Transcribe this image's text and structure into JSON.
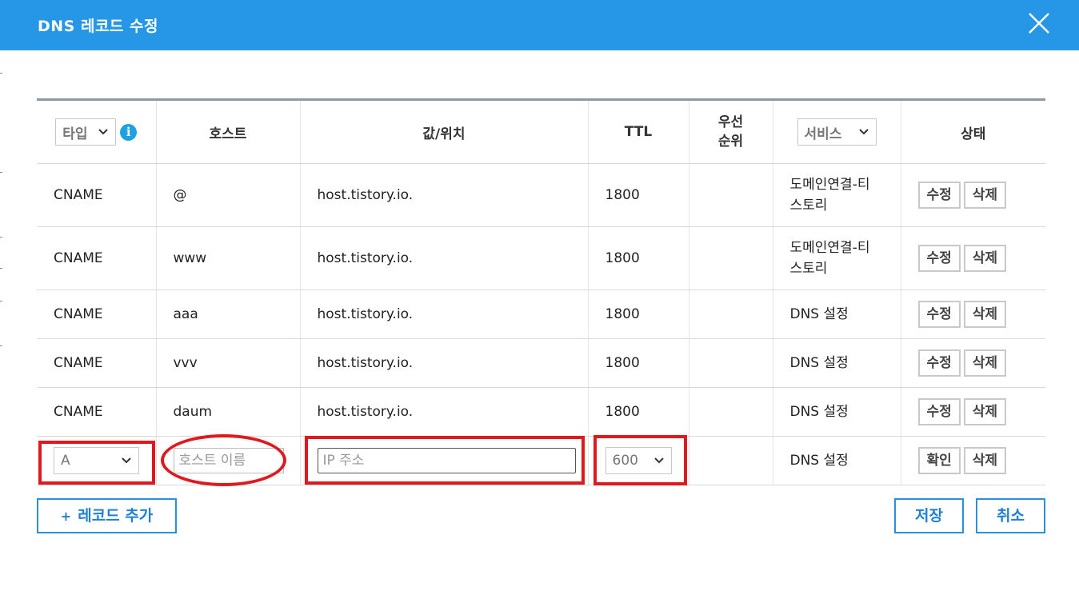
{
  "dialog": {
    "title": "DNS 레코드 수정",
    "close_icon": "close-icon"
  },
  "columns": {
    "type_filter": "타입",
    "host": "호스트",
    "value": "값/위치",
    "ttl": "TTL",
    "priority": "우선\n순위",
    "service_filter": "서비스",
    "status": "상태"
  },
  "rows": [
    {
      "type": "CNAME",
      "host": "@",
      "value": "host.tistory.io.",
      "ttl": "1800",
      "priority": "",
      "service": "도메인연결-티\n스토리",
      "edit": "수정",
      "delete": "삭제"
    },
    {
      "type": "CNAME",
      "host": "www",
      "value": "host.tistory.io.",
      "ttl": "1800",
      "priority": "",
      "service": "도메인연결-티\n스토리",
      "edit": "수정",
      "delete": "삭제"
    },
    {
      "type": "CNAME",
      "host": "aaa",
      "value": "host.tistory.io.",
      "ttl": "1800",
      "priority": "",
      "service": "DNS 설정",
      "edit": "수정",
      "delete": "삭제"
    },
    {
      "type": "CNAME",
      "host": "vvv",
      "value": "host.tistory.io.",
      "ttl": "1800",
      "priority": "",
      "service": "DNS 설정",
      "edit": "수정",
      "delete": "삭제"
    },
    {
      "type": "CNAME",
      "host": "daum",
      "value": "host.tistory.io.",
      "ttl": "1800",
      "priority": "",
      "service": "DNS 설정",
      "edit": "수정",
      "delete": "삭제"
    }
  ],
  "new_row": {
    "type_selected": "A",
    "host_placeholder": "호스트 이름",
    "host_value": "",
    "value_placeholder": "IP 주소",
    "value_value": "",
    "ttl_selected": "600",
    "service": "DNS 설정",
    "confirm": "확인",
    "delete": "삭제"
  },
  "footer": {
    "add_record": "레코드 추가",
    "save": "저장",
    "cancel": "취소"
  },
  "colors": {
    "title_bar": "#2696e6",
    "accent": "#2b8fe0",
    "annotation": "#e0191f",
    "info": "#1ea1e0"
  }
}
